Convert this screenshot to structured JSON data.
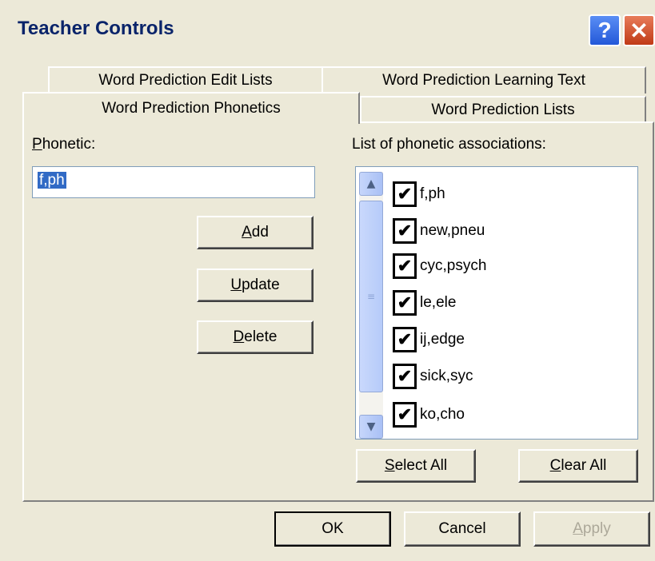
{
  "window": {
    "title": "Teacher Controls",
    "help_glyph": "?",
    "close_glyph": "✕"
  },
  "tabs": {
    "edit_lists": "Word Prediction Edit Lists",
    "learning_text": "Word Prediction Learning Text",
    "phonetics": "Word Prediction Phonetics",
    "lists": "Word Prediction Lists"
  },
  "phonetic": {
    "label_hot": "P",
    "label_rest": "honetic:",
    "value": "f,ph"
  },
  "buttons": {
    "add_hot": "A",
    "add_rest": "dd",
    "update_hot": "U",
    "update_rest": "pdate",
    "delete_hot": "D",
    "delete_rest": "elete",
    "select_all_hot": "S",
    "select_all_rest": "elect All",
    "clear_all_hot": "C",
    "clear_all_rest": "lear All",
    "ok": "OK",
    "cancel": "Cancel",
    "apply_hot": "A",
    "apply_rest": "pply"
  },
  "associations": {
    "label": "List of phonetic associations:",
    "check_glyph": "✔",
    "items": [
      {
        "text": "f,ph",
        "checked": true
      },
      {
        "text": "new,pneu",
        "checked": true
      },
      {
        "text": "cyc,psych",
        "checked": true
      },
      {
        "text": "le,ele",
        "checked": true
      },
      {
        "text": "ij,edge",
        "checked": true
      },
      {
        "text": "sick,syc",
        "checked": true
      },
      {
        "text": "ko,cho",
        "checked": true
      }
    ]
  },
  "scrollbar": {
    "up_glyph": "▲",
    "down_glyph": "▼",
    "grip_glyph": "≡"
  },
  "colors": {
    "title_text": "#0a246a",
    "selection": "#316ac5",
    "disabled_text": "#aca899"
  }
}
